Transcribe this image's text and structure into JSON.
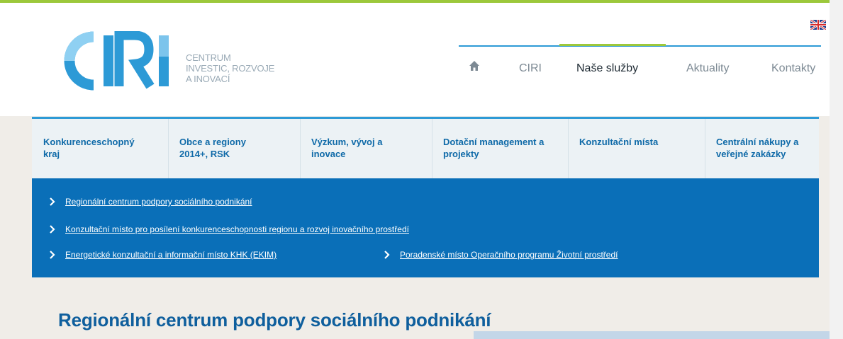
{
  "brand": {
    "logo_text": "CIRI",
    "subtitle_lines": [
      "CENTRUM",
      "INVESTIC, ROZVOJE",
      "A INOVACÍ"
    ]
  },
  "colors": {
    "accent_green": "#9cc83b",
    "accent_blue": "#2d9ad6",
    "subnav_blue": "#0a6fb8",
    "title_blue": "#0f5f9d"
  },
  "language": {
    "icon": "uk-flag-icon"
  },
  "top_nav": {
    "home_icon": "home-icon",
    "items": [
      {
        "label": "CIRI"
      },
      {
        "label": "Naše služby",
        "active": true
      },
      {
        "label": "Aktuality"
      },
      {
        "label": "Kontakty"
      }
    ]
  },
  "main_nav": {
    "items": [
      {
        "label": "Konkurenceschopný kraj"
      },
      {
        "label": "Obce a regiony 2014+, RSK"
      },
      {
        "label": "Výzkum, vývoj a inovace"
      },
      {
        "label": "Dotační management a projekty"
      },
      {
        "label": "Konzultační místa"
      },
      {
        "label": "Centrální nákupy a veřejné zakázky"
      }
    ]
  },
  "sub_nav": {
    "items": [
      {
        "label": "Regionální centrum podpory sociálního podnikání"
      },
      {
        "label": "Konzultační místo pro posílení konkurenceschopnosti regionu a rozvoj inovačního prostředí"
      },
      {
        "label": "Energetické konzultační a informační místo KHK (EKIM)"
      },
      {
        "label": "Poradenské místo Operačního programu Životní prostředí"
      }
    ]
  },
  "page": {
    "title": "Regionální centrum podpory sociálního podnikání"
  }
}
